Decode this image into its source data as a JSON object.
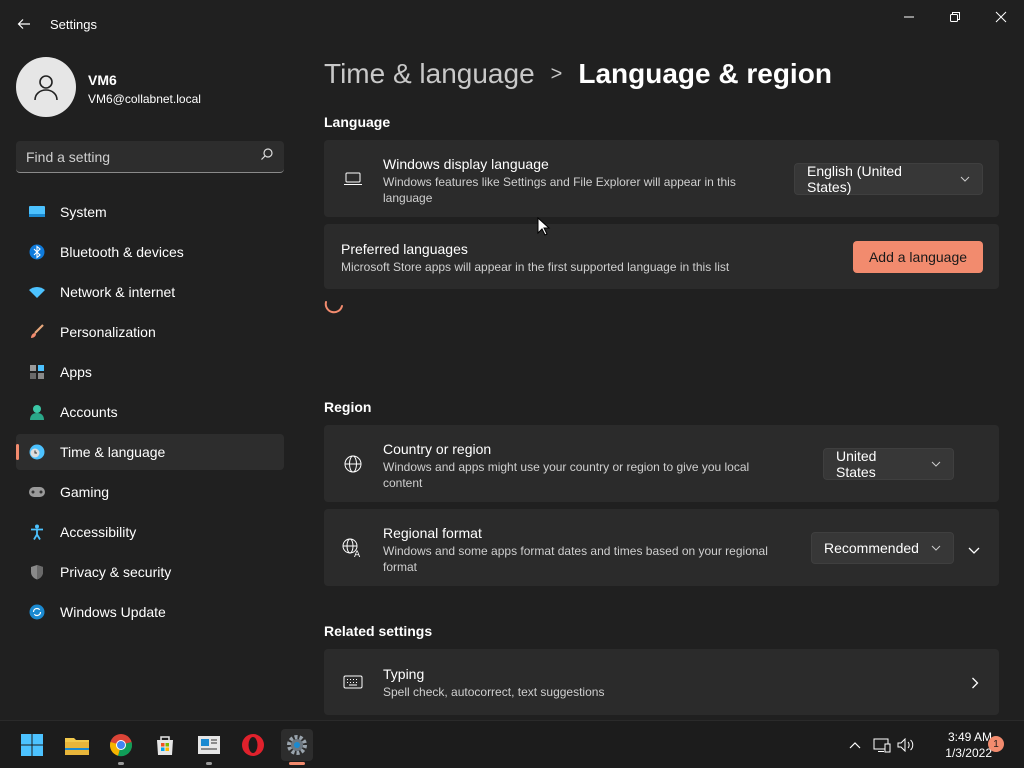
{
  "window": {
    "title": "Settings"
  },
  "profile": {
    "name": "VM6",
    "email": "VM6@collabnet.local"
  },
  "search": {
    "placeholder": "Find a setting"
  },
  "sidebar": {
    "items": [
      {
        "label": "System",
        "icon": "system-icon"
      },
      {
        "label": "Bluetooth & devices",
        "icon": "bluetooth-icon"
      },
      {
        "label": "Network & internet",
        "icon": "wifi-icon"
      },
      {
        "label": "Personalization",
        "icon": "brush-icon"
      },
      {
        "label": "Apps",
        "icon": "apps-icon"
      },
      {
        "label": "Accounts",
        "icon": "person-icon"
      },
      {
        "label": "Time & language",
        "icon": "clock-globe-icon",
        "active": true
      },
      {
        "label": "Gaming",
        "icon": "gamepad-icon"
      },
      {
        "label": "Accessibility",
        "icon": "accessibility-icon"
      },
      {
        "label": "Privacy & security",
        "icon": "shield-icon"
      },
      {
        "label": "Windows Update",
        "icon": "update-icon"
      }
    ]
  },
  "breadcrumb": {
    "parent": "Time & language",
    "separator": ">",
    "current": "Language & region"
  },
  "language_section": {
    "title": "Language",
    "display_language": {
      "title": "Windows display language",
      "description": "Windows features like Settings and File Explorer will appear in this language",
      "value": "English (United States)"
    },
    "preferred": {
      "title": "Preferred languages",
      "description": "Microsoft Store apps will appear in the first supported language in this list",
      "button": "Add a language"
    }
  },
  "region_section": {
    "title": "Region",
    "country": {
      "title": "Country or region",
      "description": "Windows and apps might use your country or region to give you local content",
      "value": "United States"
    },
    "format": {
      "title": "Regional format",
      "description": "Windows and some apps format dates and times based on your regional format",
      "value": "Recommended"
    }
  },
  "related_section": {
    "title": "Related settings",
    "typing": {
      "title": "Typing",
      "description": "Spell check, autocorrect, text suggestions"
    }
  },
  "taskbar": {
    "apps": [
      "start-icon",
      "file-explorer-icon",
      "chrome-icon",
      "store-icon",
      "news-icon",
      "opera-icon",
      "settings-icon"
    ],
    "time": "3:49 AM",
    "date": "1/3/2022",
    "notification_count": "1"
  },
  "colors": {
    "accent": "#f28b6e",
    "background": "#202020",
    "card": "#2b2b2b"
  }
}
